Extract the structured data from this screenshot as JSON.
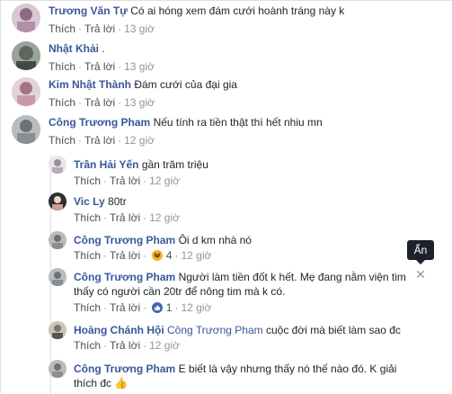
{
  "comments": [
    {
      "name": "Trương Văn Tự",
      "text": "Có ai hóng xem đám cưới hoành tráng này k",
      "like": "Thích",
      "reply": "Trả lời",
      "time": "13 giờ"
    },
    {
      "name": "Nhật Khải",
      "text": ".",
      "like": "Thích",
      "reply": "Trả lời",
      "time": "13 giờ"
    },
    {
      "name": "Kim Nhật Thành",
      "text": "Đám cưới của đại gia",
      "like": "Thích",
      "reply": "Trả lời",
      "time": "13 giờ"
    },
    {
      "name": "Công Trương Pham",
      "text": "Nếu tính ra tiền thật thì hết nhiu mn",
      "like": "Thích",
      "reply": "Trả lời",
      "time": "12 giờ"
    }
  ],
  "replies": [
    {
      "name": "Trần Hải Yến",
      "text": "gần trăm triệu",
      "like": "Thích",
      "reply": "Trả lời",
      "time": "12 giờ"
    },
    {
      "name": "Vic Ly",
      "text": "80tr",
      "like": "Thích",
      "reply": "Trả lời",
      "time": "12 giờ"
    },
    {
      "name": "Công Trương Pham",
      "text": "Ôi d km nhà nó",
      "like": "Thích",
      "reply": "Trả lời",
      "reaction_count": "4",
      "time": "12 giờ"
    },
    {
      "name": "Công Trương Pham",
      "text_line1": "Người làm tiền đốt k hết. Mẹ đang nằm viện tim",
      "text_line2": "thấy có người cần 20tr để nông tim mà k có.",
      "like": "Thích",
      "reply": "Trả lời",
      "reaction_count": "1",
      "time": "12 giờ"
    },
    {
      "name": "Hoàng Chánh Hội",
      "mention": "Công Trương Pham",
      "text": "cuộc đời mà biết làm sao đc",
      "like": "Thích",
      "reply": "Trả lời",
      "time": "12 giờ"
    },
    {
      "name": "Công Trương Pham",
      "text_line1": "E biết là vậy nhưng thấy nó thế nào đó. K giải",
      "text_line2": "thích đc",
      "emoji": "👍"
    }
  ],
  "tooltip": {
    "label": "Ẩn"
  },
  "icons": {
    "hide": "close-icon",
    "haha": "haha-reaction-icon",
    "like": "like-reaction-icon"
  }
}
